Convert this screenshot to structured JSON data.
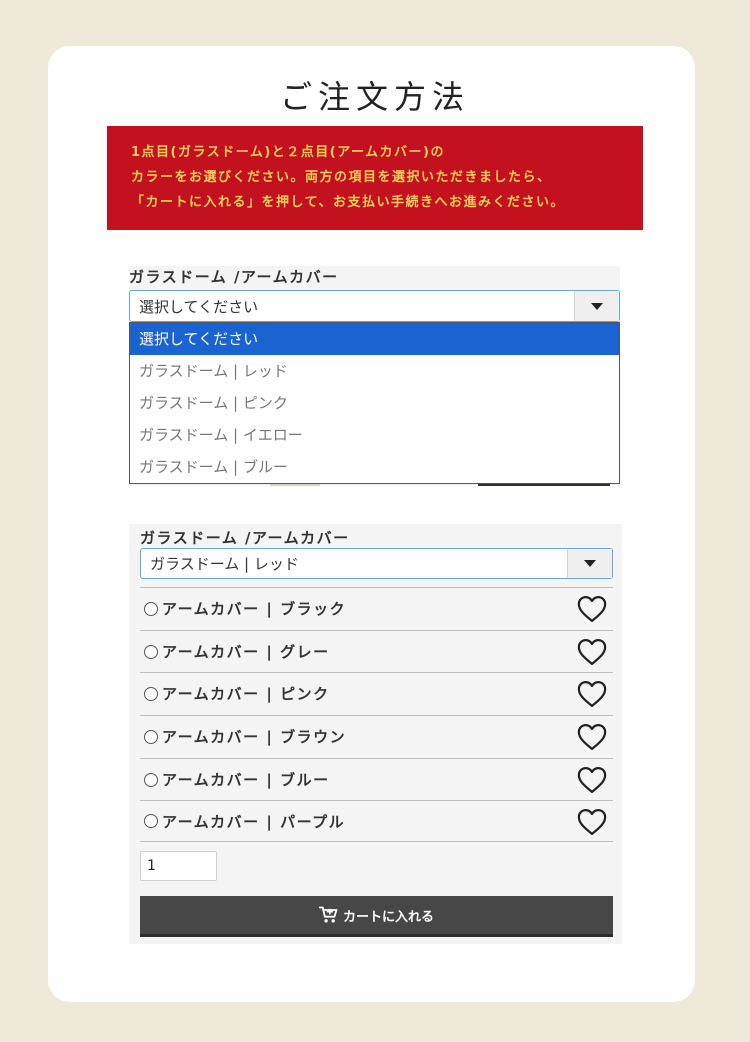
{
  "page": {
    "title": "ご注文方法"
  },
  "notice": {
    "line1": "1点目(ガラスドーム)と２点目(アームカバー)の",
    "line2": "カラーをお選びください。両方の項目を選択いただきましたら、",
    "line3": "「カートに入れる」を押して、お支払い手続きへお進みください。"
  },
  "form1": {
    "label": "ガラスドーム /アームカバー",
    "selected_value": "選択してください",
    "dropdown_options": [
      "選択してください",
      "ガラスドーム | レッド",
      "ガラスドーム | ピンク",
      "ガラスドーム | イエロー",
      "ガラスドーム | ブルー"
    ]
  },
  "form2": {
    "label": "ガラスドーム /アームカバー",
    "selected_value": "ガラスドーム | レッド",
    "options": [
      "アームカバー | ブラック",
      "アームカバー | グレー",
      "アームカバー | ピンク",
      "アームカバー | ブラウン",
      "アームカバー | ブルー",
      "アームカバー | パープル"
    ],
    "quantity": "1",
    "cart_button": "カートに入れる"
  },
  "colors": {
    "background": "#efe9da",
    "notice_bg": "#c3111f",
    "notice_text": "#f5d15b",
    "highlight": "#1a63d0",
    "cart_button": "#474747"
  }
}
